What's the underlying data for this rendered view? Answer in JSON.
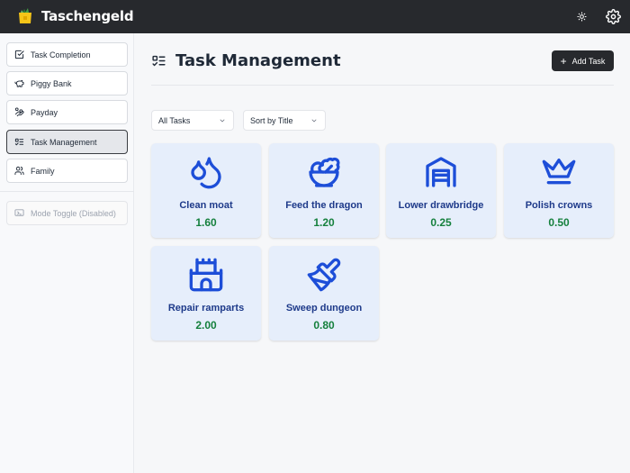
{
  "app": {
    "title": "Taschengeld"
  },
  "sidebar": {
    "items": [
      {
        "label": "Task Completion",
        "icon": "check-square-icon"
      },
      {
        "label": "Piggy Bank",
        "icon": "piggy-bank-icon"
      },
      {
        "label": "Payday",
        "icon": "payday-icon"
      },
      {
        "label": "Task Management",
        "icon": "list-checks-icon",
        "active": true
      },
      {
        "label": "Family",
        "icon": "users-icon"
      }
    ],
    "mode_toggle": {
      "label": "Mode Toggle (Disabled)",
      "icon": "toggle-icon"
    }
  },
  "main": {
    "title": "Task Management",
    "add_button": "Add Task",
    "filter": {
      "selected": "All Tasks"
    },
    "sort": {
      "selected": "Sort by Title"
    },
    "tasks": [
      {
        "name": "Clean moat",
        "value": "1.60",
        "icon": "droplets-icon"
      },
      {
        "name": "Feed the dragon",
        "value": "1.20",
        "icon": "salad-bowl-icon"
      },
      {
        "name": "Lower drawbridge",
        "value": "0.25",
        "icon": "garage-gate-icon"
      },
      {
        "name": "Polish crowns",
        "value": "0.50",
        "icon": "crown-icon"
      },
      {
        "name": "Repair ramparts",
        "value": "2.00",
        "icon": "castle-icon"
      },
      {
        "name": "Sweep dungeon",
        "value": "0.80",
        "icon": "paintbrush-icon"
      }
    ]
  },
  "colors": {
    "topbar": "#27292d",
    "card_bg": "#e6eefb",
    "icon_blue": "#1d4ed8",
    "task_name": "#1e3a8a",
    "task_value": "#15803d"
  }
}
